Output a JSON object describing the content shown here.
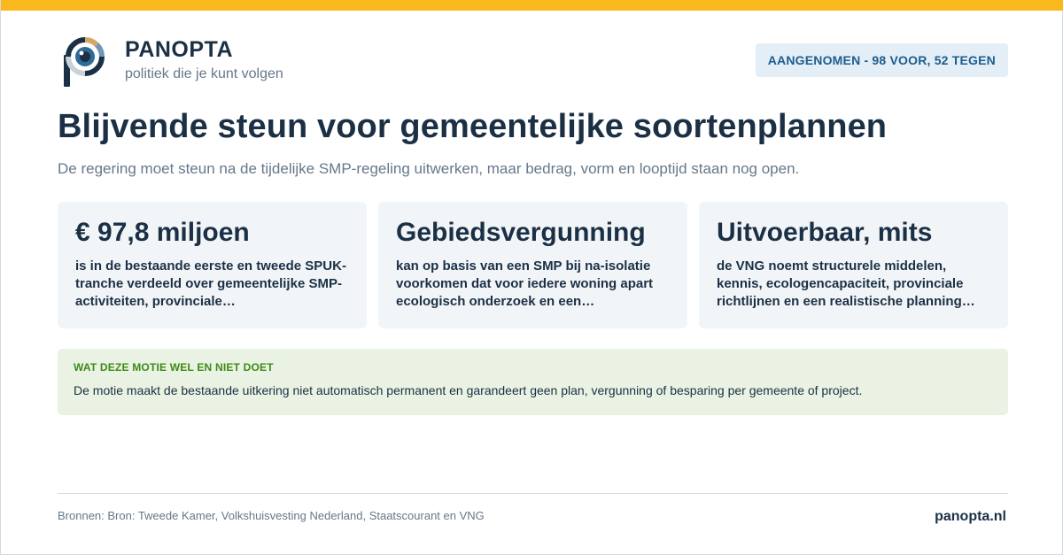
{
  "brand": {
    "name": "PANOPTA",
    "tagline": "politiek die je kunt volgen",
    "logo_icon": "eye-p-logo-icon"
  },
  "status": {
    "label": "AANGENOMEN - 98 VOOR, 52 TEGEN"
  },
  "headline": {
    "title": "Blijvende steun voor gemeentelijke soortenplannen",
    "subtitle": "De regering moet steun na de tijdelijke SMP-regeling uitwerken, maar bedrag, vorm en looptijd staan nog open."
  },
  "cards": [
    {
      "title": "€ 97,8 miljoen",
      "text": "is in de bestaande eerste en tweede SPUK-tranche verdeeld over gemeentelijke SMP-activiteiten, provinciale…"
    },
    {
      "title": "Gebiedsvergunning",
      "text": "kan op basis van een SMP bij na-isolatie voorkomen dat voor iedere woning apart ecologisch onderzoek en een…"
    },
    {
      "title": "Uitvoerbaar, mits",
      "text": "de VNG noemt structurele middelen, kennis, ecologencapaciteit, provinciale richtlijnen en een realistische planning als…"
    }
  ],
  "note": {
    "label": "WAT DEZE MOTIE WEL EN NIET DOET",
    "text": "De motie maakt de bestaande uitkering niet automatisch permanent en garandeert geen plan, vergunning of besparing per gemeente of project."
  },
  "footer": {
    "sources": "Bronnen: Bron: Tweede Kamer, Volkshuisvesting Nederland, Staatscourant en VNG",
    "domain": "panopta.nl"
  },
  "colors": {
    "accent": "#fbb81c",
    "navy": "#1b3045",
    "status_bg": "#e4eef6",
    "status_text": "#1c5d8e",
    "note_bg": "#e9f2e3",
    "note_label": "#3c8a17",
    "card_bg": "#f2f5f8"
  }
}
